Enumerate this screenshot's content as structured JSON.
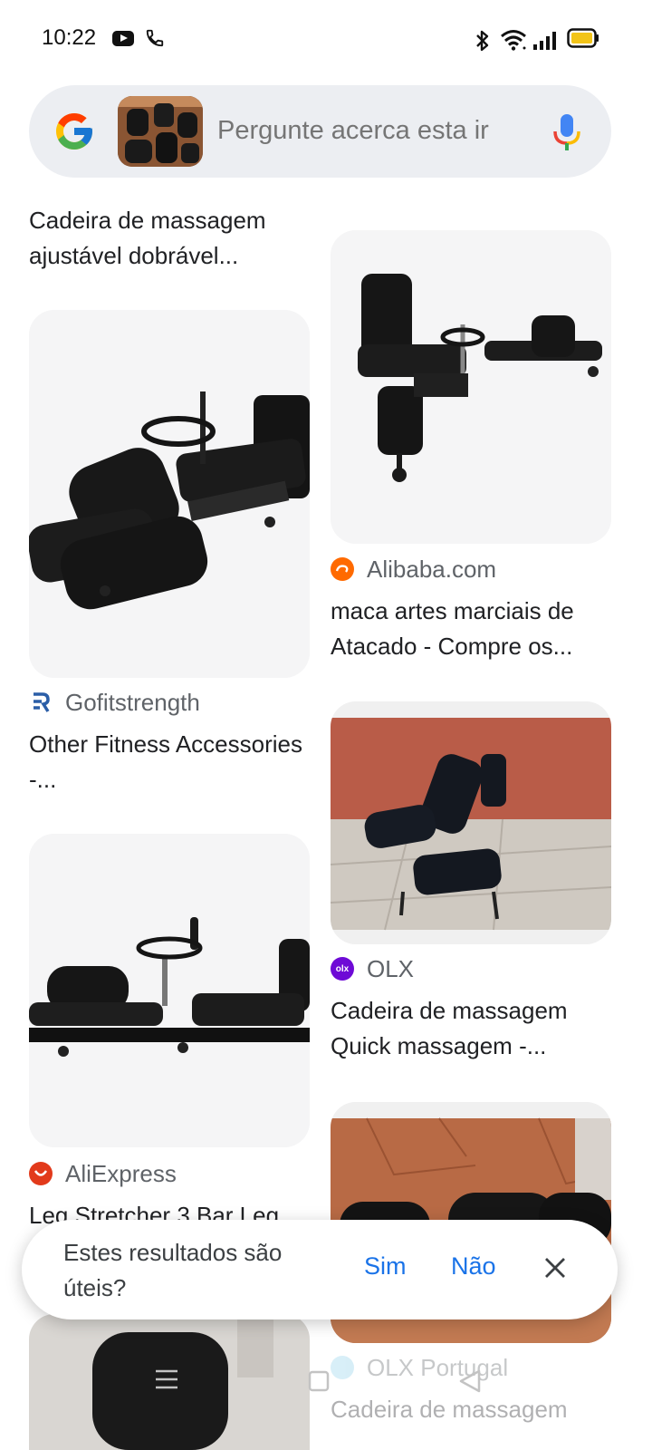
{
  "status_bar": {
    "time": "10:22"
  },
  "search": {
    "placeholder": "Pergunte acerca esta ir"
  },
  "results": {
    "left": [
      {
        "title": "Cadeira de massagem ajustável dobrável..."
      },
      {
        "source": "Gofitstrength",
        "title": "Other Fitness Accessories -..."
      },
      {
        "source": "AliExpress",
        "title": "Leg Stretcher 3 Bar Leg"
      }
    ],
    "right": [
      {
        "source": "Alibaba.com",
        "title": "maca artes marciais de Atacado - Compre os..."
      },
      {
        "source": "OLX",
        "title": "Cadeira de massagem Quick massagem -..."
      },
      {
        "source": "OLX Portugal",
        "title": "Cadeira de massagem"
      }
    ]
  },
  "feedback": {
    "question": "Estes resultados são úteis?",
    "yes_label": "Sim",
    "no_label": "Não"
  },
  "colors": {
    "accent": "#1a73e8",
    "search_bg": "#eceef2",
    "text": "#202124",
    "secondary_text": "#5f6368"
  },
  "icons": {
    "status_left": [
      "youtube-icon",
      "phone-icon"
    ],
    "status_right": [
      "bluetooth-icon",
      "wifi-icon",
      "signal-icon",
      "battery-icon"
    ],
    "search": [
      "google-logo-icon",
      "mic-icon"
    ],
    "navigation": [
      "menu-icon",
      "home-icon",
      "back-icon"
    ]
  }
}
